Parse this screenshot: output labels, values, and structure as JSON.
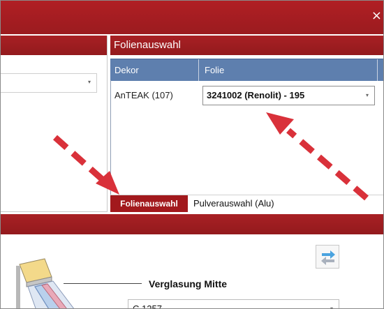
{
  "window": {
    "close_glyph": "×"
  },
  "left_panel": {
    "dropdown_arrow": "▾"
  },
  "foil_panel": {
    "title": "Folienauswahl",
    "columns": {
      "dekor": "Dekor",
      "folie": "Folie"
    },
    "row": {
      "dekor": "AnTEAK (107)",
      "folie": "3241002 (Renolit) - 195"
    },
    "dropdown_arrow": "▾"
  },
  "tabs": [
    {
      "label": "Folienauswahl",
      "active": true
    },
    {
      "label": "Pulverauswahl (Alu)",
      "active": false
    }
  ],
  "glazing": {
    "label": "Verglasung Mitte",
    "select_value": "C 1257",
    "dropdown_arrow": "▾"
  },
  "colors": {
    "accent_red": "#a2191d",
    "grid_header_blue": "#5e7fae",
    "annotation_red": "#d9313a"
  },
  "icons": [
    "close-icon",
    "chevron-down-icon",
    "swap-arrows-icon",
    "window-glazing-illustration",
    "annotation-arrow"
  ]
}
